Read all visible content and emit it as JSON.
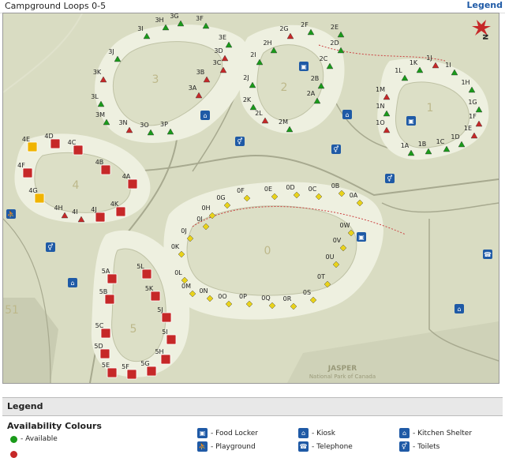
{
  "header": {
    "title": "Campground Loops 0-5",
    "legend_link": "Legend"
  },
  "map": {
    "brand_line1": "JASPER",
    "brand_line2": "National Park of Canada",
    "loops": [
      {
        "name": "0"
      },
      {
        "name": "1"
      },
      {
        "name": "2"
      },
      {
        "name": "3"
      },
      {
        "name": "4"
      },
      {
        "name": "5"
      },
      {
        "name": "51"
      }
    ],
    "sites": [
      {
        "id": "1A",
        "kind": "available"
      },
      {
        "id": "1B",
        "kind": "available"
      },
      {
        "id": "1C",
        "kind": "available"
      },
      {
        "id": "1D",
        "kind": "available"
      },
      {
        "id": "1E",
        "kind": "unavailable"
      },
      {
        "id": "1F",
        "kind": "unavailable"
      },
      {
        "id": "1G",
        "kind": "available"
      },
      {
        "id": "1H",
        "kind": "available"
      },
      {
        "id": "1I",
        "kind": "available"
      },
      {
        "id": "1J",
        "kind": "unavailable"
      },
      {
        "id": "1K",
        "kind": "available"
      },
      {
        "id": "1L",
        "kind": "available"
      },
      {
        "id": "1M",
        "kind": "unavailable"
      },
      {
        "id": "1N",
        "kind": "available"
      },
      {
        "id": "1O",
        "kind": "unavailable"
      },
      {
        "id": "2A",
        "kind": "available"
      },
      {
        "id": "2B",
        "kind": "available"
      },
      {
        "id": "2C",
        "kind": "available"
      },
      {
        "id": "2D",
        "kind": "available"
      },
      {
        "id": "2E",
        "kind": "available"
      },
      {
        "id": "2F",
        "kind": "available"
      },
      {
        "id": "2G",
        "kind": "unavailable"
      },
      {
        "id": "2H",
        "kind": "available"
      },
      {
        "id": "2I",
        "kind": "available"
      },
      {
        "id": "2J",
        "kind": "available"
      },
      {
        "id": "2K",
        "kind": "available"
      },
      {
        "id": "2L",
        "kind": "unavailable"
      },
      {
        "id": "2M",
        "kind": "available"
      },
      {
        "id": "3A",
        "kind": "unavailable"
      },
      {
        "id": "3B",
        "kind": "unavailable"
      },
      {
        "id": "3C",
        "kind": "unavailable"
      },
      {
        "id": "3D",
        "kind": "unavailable"
      },
      {
        "id": "3E",
        "kind": "available"
      },
      {
        "id": "3F",
        "kind": "available"
      },
      {
        "id": "3G",
        "kind": "available"
      },
      {
        "id": "3H",
        "kind": "available"
      },
      {
        "id": "3I",
        "kind": "available"
      },
      {
        "id": "3J",
        "kind": "available"
      },
      {
        "id": "3K",
        "kind": "unavailable"
      },
      {
        "id": "3L",
        "kind": "available"
      },
      {
        "id": "3M",
        "kind": "available"
      },
      {
        "id": "3N",
        "kind": "unavailable"
      },
      {
        "id": "3O",
        "kind": "available"
      },
      {
        "id": "3P",
        "kind": "available"
      },
      {
        "id": "4A",
        "kind": "shelter"
      },
      {
        "id": "4B",
        "kind": "shelter"
      },
      {
        "id": "4C",
        "kind": "shelter"
      },
      {
        "id": "4D",
        "kind": "shelter"
      },
      {
        "id": "4E",
        "kind": "group"
      },
      {
        "id": "4F",
        "kind": "shelter"
      },
      {
        "id": "4G",
        "kind": "group"
      },
      {
        "id": "4H",
        "kind": "unavailable"
      },
      {
        "id": "4I",
        "kind": "unavailable"
      },
      {
        "id": "4J",
        "kind": "shelter"
      },
      {
        "id": "4K",
        "kind": "shelter"
      },
      {
        "id": "5A",
        "kind": "shelter"
      },
      {
        "id": "5B",
        "kind": "shelter"
      },
      {
        "id": "5C",
        "kind": "shelter"
      },
      {
        "id": "5D",
        "kind": "shelter"
      },
      {
        "id": "5E",
        "kind": "shelter"
      },
      {
        "id": "5F",
        "kind": "shelter"
      },
      {
        "id": "5G",
        "kind": "shelter"
      },
      {
        "id": "5H",
        "kind": "shelter"
      },
      {
        "id": "5I",
        "kind": "shelter"
      },
      {
        "id": "5J",
        "kind": "shelter"
      },
      {
        "id": "5K",
        "kind": "shelter"
      },
      {
        "id": "5L",
        "kind": "shelter"
      },
      {
        "id": "0A",
        "kind": "diamond"
      },
      {
        "id": "0B",
        "kind": "diamond"
      },
      {
        "id": "0C",
        "kind": "diamond"
      },
      {
        "id": "0D",
        "kind": "diamond"
      },
      {
        "id": "0E",
        "kind": "diamond"
      },
      {
        "id": "0F",
        "kind": "diamond"
      },
      {
        "id": "0G",
        "kind": "diamond"
      },
      {
        "id": "0H",
        "kind": "diamond"
      },
      {
        "id": "0I",
        "kind": "diamond"
      },
      {
        "id": "0J",
        "kind": "diamond"
      },
      {
        "id": "0K",
        "kind": "diamond"
      },
      {
        "id": "0L",
        "kind": "diamond"
      },
      {
        "id": "0M",
        "kind": "diamond"
      },
      {
        "id": "0N",
        "kind": "diamond"
      },
      {
        "id": "0O",
        "kind": "diamond"
      },
      {
        "id": "0P",
        "kind": "diamond"
      },
      {
        "id": "0Q",
        "kind": "diamond"
      },
      {
        "id": "0R",
        "kind": "diamond"
      },
      {
        "id": "0S",
        "kind": "diamond"
      },
      {
        "id": "0T",
        "kind": "diamond"
      },
      {
        "id": "0U",
        "kind": "diamond"
      },
      {
        "id": "0V",
        "kind": "diamond"
      },
      {
        "id": "0W",
        "kind": "diamond"
      }
    ]
  },
  "legend": {
    "title": "Legend",
    "availability_title": "Availability Colours",
    "available_label": "- Available",
    "items": [
      {
        "icon": "food-locker-icon",
        "label": "- Food Locker"
      },
      {
        "icon": "playground-icon",
        "label": "- Playground"
      },
      {
        "icon": "kiosk-icon",
        "label": "- Kiosk"
      },
      {
        "icon": "telephone-icon",
        "label": "- Telephone"
      },
      {
        "icon": "kitchen-shelter-icon",
        "label": "- Kitchen Shelter"
      },
      {
        "icon": "toilets-icon",
        "label": "- Toilets"
      }
    ],
    "colors": {
      "available": "#1a9a1a",
      "unavailable": "#c62828",
      "shelter": "#c62828",
      "diamond": "#e8d21a",
      "accent": "#1f5aa6"
    }
  }
}
